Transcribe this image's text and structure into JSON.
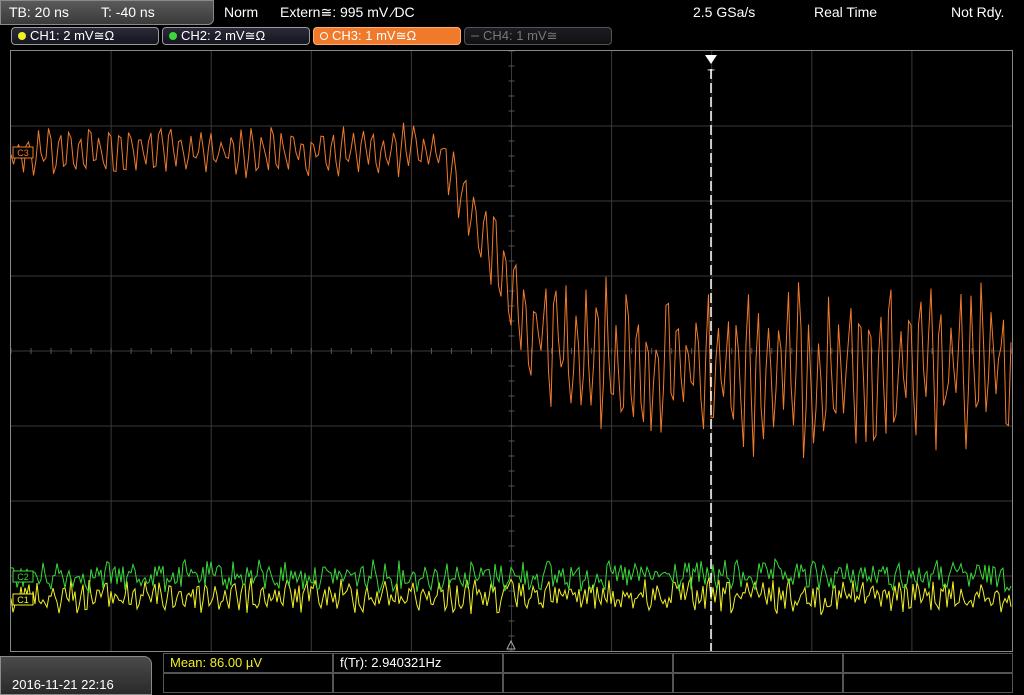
{
  "header": {
    "timebase": "TB: 20 ns",
    "trigger_time": "T: -40 ns",
    "trigger_mode": "Norm",
    "trigger_source": "Extern≅: 995 mV ⁄DC",
    "sample_rate": "2.5 GSa/s",
    "acq_mode": "Real Time",
    "status": "Not Rdy."
  },
  "channels": [
    {
      "label": "CH1: 2 mV≅Ω",
      "color": "#f0f028",
      "state": "on"
    },
    {
      "label": "CH2: 2 mV≅Ω",
      "color": "#3ad83a",
      "state": "on"
    },
    {
      "label": "CH3: 1 mV≅Ω",
      "color": "#f07a2c",
      "state": "active"
    },
    {
      "label": "CH4: 1 mV≅",
      "color": "#777777",
      "state": "off"
    }
  ],
  "markers": {
    "ch3": "C3",
    "ch2": "C2",
    "ch1": "C1",
    "trigger": "T"
  },
  "measurements": {
    "mean": "Mean: 86.00 µV",
    "freq": "f(Tr): 2.940321Hz"
  },
  "footer": {
    "datetime": "2016-11-21 22:16"
  },
  "colors": {
    "ch1": "#f0f028",
    "ch2": "#3ad83a",
    "ch3": "#f07a2c",
    "grid": "#3a3a3a"
  }
}
